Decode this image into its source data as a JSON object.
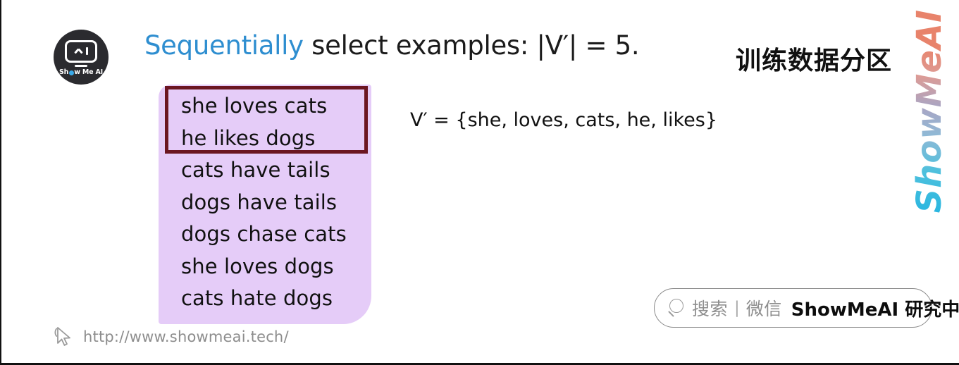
{
  "slide": {
    "title": {
      "highlight": "Sequentially",
      "rest": " select examples: |V′| = 5."
    },
    "logo": {
      "brand_top": "Sh",
      "brand_mid": "w Me AI",
      "icon_name": "robot-face-icon"
    },
    "sentence_box": {
      "lines": [
        "she loves cats",
        "he likes dogs",
        "cats have tails",
        "dogs have tails",
        "dogs chase cats",
        "she loves dogs",
        "cats hate dogs"
      ],
      "highlighted_count": 2,
      "background_color": "#E5CCF8",
      "highlight_border_color": "#6B1621"
    },
    "vocabulary_note": "V′ = {she, loves, cats, he, likes}",
    "chinese_heading": "训练数据分区",
    "watermark": "ShowMeAI",
    "search_pill": {
      "icon_name": "search-icon",
      "placeholder": "搜索",
      "separator": "|",
      "channel": "微信",
      "account": "ShowMeAI 研究中心"
    },
    "footer": {
      "icon_name": "cursor-pointer-icon",
      "url": "http://www.showmeai.tech/"
    },
    "colors": {
      "accent_blue": "#2E8ED0",
      "lavender": "#E5CCF8",
      "maroon": "#6B1621",
      "gray_text": "#8D8D8D"
    }
  }
}
